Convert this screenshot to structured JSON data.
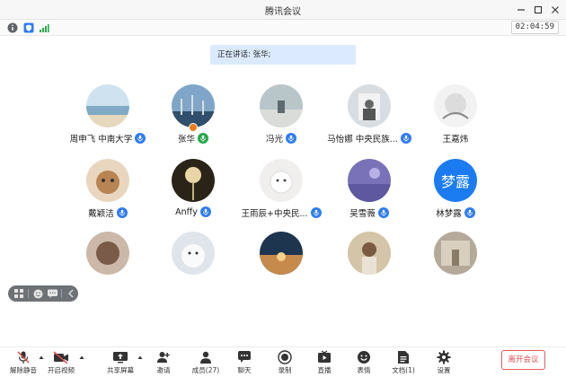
{
  "window": {
    "title": "腾讯会议"
  },
  "infobar": {
    "timer": "02:04:59"
  },
  "speaking": {
    "text": "正在讲话: 张华;"
  },
  "participants": [
    {
      "name": "周申飞 中南大学",
      "mic": "blue",
      "avatar": "beach"
    },
    {
      "name": "张华",
      "mic": "green",
      "avatar": "harbor",
      "host": true
    },
    {
      "name": "冯光",
      "mic": "blue",
      "avatar": "courtyard"
    },
    {
      "name": "马怡娜 中央民族...",
      "mic": "blue",
      "avatar": "portrait"
    },
    {
      "name": "王嘉炜",
      "mic": "none",
      "avatar": "sketch"
    },
    {
      "name": "戴颖洁",
      "mic": "blue",
      "avatar": "cat"
    },
    {
      "name": "Anffy",
      "mic": "blue",
      "avatar": "flower"
    },
    {
      "name": "王雨辰+中央民...",
      "mic": "blue",
      "avatar": "cartoon"
    },
    {
      "name": "吴雪薇",
      "mic": "blue",
      "avatar": "purple"
    },
    {
      "name": "林梦露",
      "mic": "blue",
      "avatar": "text",
      "avatar_text": "梦露"
    },
    {
      "name": "",
      "mic": "none",
      "avatar": "anime"
    },
    {
      "name": "",
      "mic": "none",
      "avatar": "bird"
    },
    {
      "name": "",
      "mic": "none",
      "avatar": "sunset"
    },
    {
      "name": "",
      "mic": "none",
      "avatar": "girl"
    },
    {
      "name": "",
      "mic": "none",
      "avatar": "room"
    }
  ],
  "toolbar": {
    "unmute": "解除静音",
    "video": "开启视频",
    "share": "共享屏幕",
    "invite": "邀请",
    "members": "成员(27)",
    "chat": "聊天",
    "record": "录制",
    "live": "直播",
    "reactions": "表情",
    "docs": "文档(1)",
    "settings": "设置",
    "leave": "离开会议"
  },
  "colors": {
    "accent": "#2f7cf6",
    "speaking_bg": "#dbeaff",
    "leave": "#e14b4b",
    "mic_active": "#26a84a"
  }
}
